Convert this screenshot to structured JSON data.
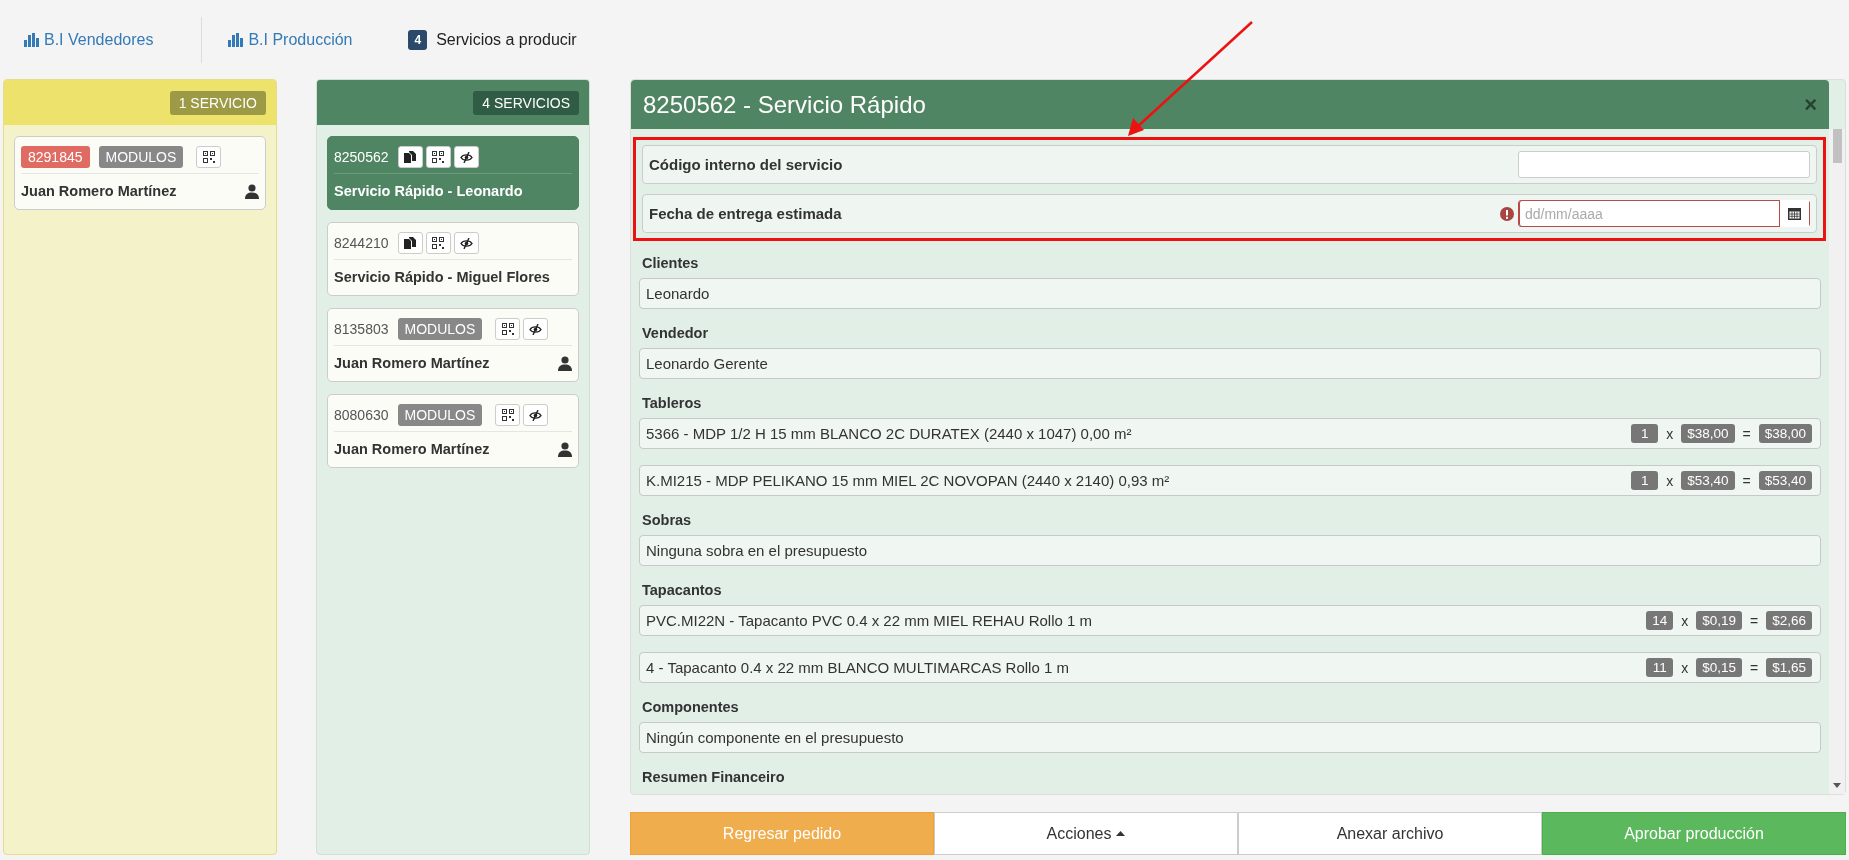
{
  "nav": [
    {
      "kind": "link",
      "label": "B.I Vendedores",
      "selected": false
    },
    {
      "kind": "link",
      "label": "B.I Producción",
      "selected": false
    },
    {
      "kind": "count",
      "badge": "4",
      "label": "Servicios a producir",
      "selected": true
    }
  ],
  "columns": [
    {
      "kind": "pending",
      "badge": "1 SERVICIO",
      "cards": [
        {
          "number": "8291845",
          "alert": true,
          "tag": "MODULOS",
          "icons": [
            {
              "kind": "qr"
            }
          ],
          "name": "Juan Romero Martínez",
          "user": true,
          "selected": false
        }
      ]
    },
    {
      "kind": "production",
      "badge": "4 SERVICIOS",
      "cards": [
        {
          "number": "8250562",
          "alert": false,
          "icons": [
            {
              "kind": "files"
            },
            {
              "kind": "qr"
            },
            {
              "kind": "eye"
            }
          ],
          "name": "Servicio Rápido - Leonardo",
          "user": false,
          "selected": true
        },
        {
          "number": "8244210",
          "alert": false,
          "icons": [
            {
              "kind": "files"
            },
            {
              "kind": "qr"
            },
            {
              "kind": "eye"
            }
          ],
          "name": "Servicio Rápido - Miguel Flores",
          "user": false,
          "selected": false
        },
        {
          "number": "8135803",
          "alert": false,
          "tag": "MODULOS",
          "icons": [
            {
              "kind": "qr"
            },
            {
              "kind": "eye"
            }
          ],
          "name": "Juan Romero Martínez",
          "user": true,
          "selected": false
        },
        {
          "number": "8080630",
          "alert": false,
          "tag": "MODULOS",
          "icons": [
            {
              "kind": "qr"
            },
            {
              "kind": "eye"
            }
          ],
          "name": "Juan Romero Martínez",
          "user": true,
          "selected": false
        }
      ]
    }
  ],
  "modal": {
    "title": "8250562 - Servicio Rápido",
    "close": "×",
    "highlighted": true,
    "fields": [
      {
        "kind": "text",
        "label": "Código interno del servicio"
      },
      {
        "kind": "date",
        "label": "Fecha de entrega estimada",
        "placeholder": "dd/mm/aaaa",
        "error": true
      }
    ],
    "sections": [
      {
        "title": "Clientes",
        "items": [
          {
            "text": "Leonardo"
          }
        ]
      },
      {
        "title": "Vendedor",
        "items": [
          {
            "text": "Leonardo Gerente"
          }
        ]
      },
      {
        "title": "Tableros",
        "items": [
          {
            "text": "5366 - MDP 1/2 H 15 mm BLANCO 2C DURATEX (2440 x 1047) 0,00 m²",
            "qty": "1",
            "times": "x",
            "price": "$38,00",
            "equals": "=",
            "total": "$38,00"
          },
          {
            "text": "K.MI215 - MDP PELIKANO 15 mm MIEL 2C NOVOPAN (2440 x 2140) 0,93 m²",
            "qty": "1",
            "times": "x",
            "price": "$53,40",
            "equals": "=",
            "total": "$53,40"
          }
        ]
      },
      {
        "title": "Sobras",
        "items": [
          {
            "text": "Ninguna sobra en el presupuesto"
          }
        ]
      },
      {
        "title": "Tapacantos",
        "items": [
          {
            "text": "PVC.MI22N - Tapacanto PVC 0.4 x 22 mm MIEL REHAU Rollo 1 m",
            "qty": "14",
            "times": "x",
            "price": "$0,19",
            "equals": "=",
            "total": "$2,66"
          },
          {
            "text": "4 - Tapacanto 0.4 x 22 mm BLANCO MULTIMARCAS Rollo 1 m",
            "qty": "11",
            "times": "x",
            "price": "$0,15",
            "equals": "=",
            "total": "$1,65"
          }
        ]
      },
      {
        "title": "Componentes",
        "items": [
          {
            "text": "Ningún componente en el presupuesto"
          }
        ]
      },
      {
        "title": "Resumen Financeiro"
      }
    ]
  },
  "actions": [
    {
      "kind": "warning",
      "label": "Regresar pedido"
    },
    {
      "kind": "dropdown",
      "label": "Acciones"
    },
    {
      "kind": "default",
      "label": "Anexar archivo"
    },
    {
      "kind": "success",
      "label": "Aprobar producción"
    }
  ]
}
